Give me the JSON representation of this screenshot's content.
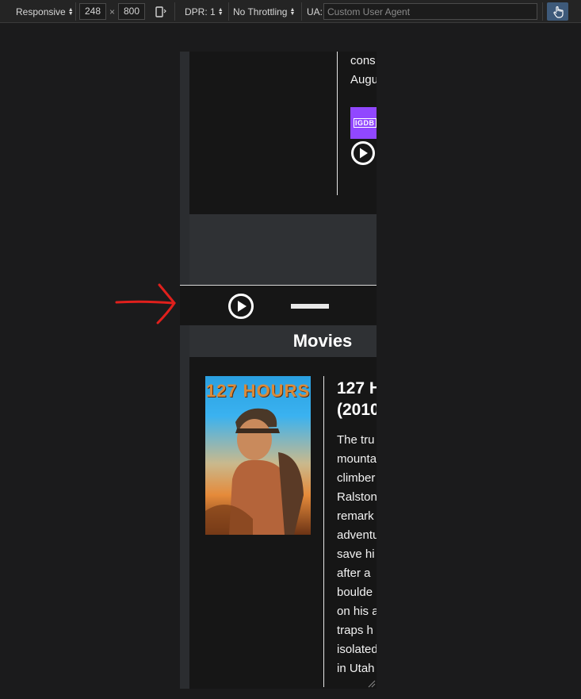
{
  "toolbar": {
    "device": "Responsive",
    "width": "248",
    "times": "×",
    "height": "800",
    "dpr": "DPR: 1",
    "throttling": "No Throttling",
    "ua_label": "UA:",
    "ua_placeholder": "Custom User Agent"
  },
  "top_card": {
    "lines": [
      "cons",
      "Augu"
    ],
    "igdb_label": "IGDB"
  },
  "section": {
    "title": "Movies"
  },
  "movie": {
    "poster_title": "127 HOURS",
    "title_lines": [
      "127 H",
      "(2010"
    ],
    "description_lines": [
      "The tru",
      "mounta",
      "climber",
      "Ralston",
      "remark",
      "adventu",
      "save hi",
      "after a",
      "boulde",
      "on his a",
      "traps h",
      "isolated",
      "in Utah"
    ]
  },
  "colors": {
    "annotation_arrow": "#e0201c",
    "igdb": "#9147ff",
    "card_bg": "#161616",
    "page_bg": "#2f3134"
  }
}
